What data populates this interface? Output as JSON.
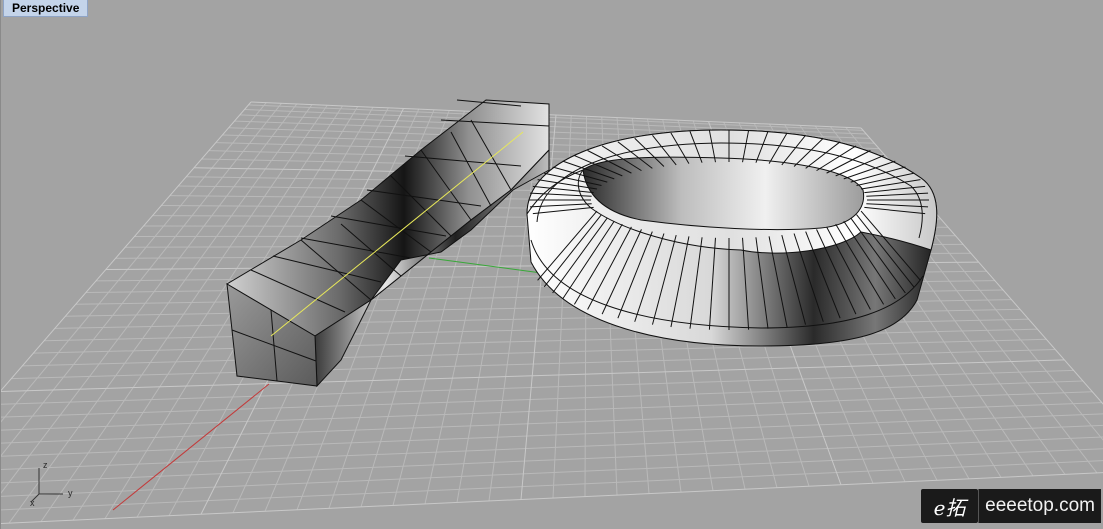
{
  "viewport": {
    "label": "Perspective"
  },
  "axis_widget": {
    "z": "z",
    "y": "y",
    "x": "x"
  },
  "watermark": {
    "logo_glyph": "e拓",
    "text": "eeeetop.com"
  },
  "colors": {
    "background": "#a3a3a3",
    "grid_line": "#b8b8b8",
    "x_axis": "#c33b3b",
    "y_axis": "#38a838",
    "curve": "#e8e85a",
    "mesh_edge": "#111111"
  },
  "objects": [
    {
      "name": "twisted-square-bar"
    },
    {
      "name": "mobius-ring"
    }
  ]
}
